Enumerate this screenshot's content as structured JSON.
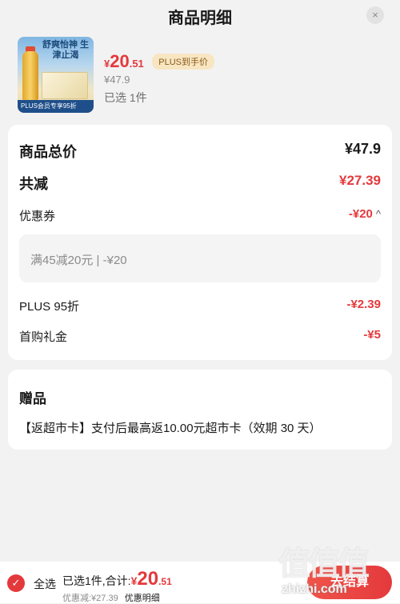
{
  "header": {
    "title": "商品明细",
    "close_icon": "×"
  },
  "product": {
    "thumb_slogan": "舒爽怡神 生津止渴",
    "thumb_banner": "PLUS会员专享95折",
    "price_symbol": "¥",
    "price_main": "20",
    "price_decimal": ".51",
    "plus_badge": "PLUS到手价",
    "original_price": "¥47.9",
    "selected": "已选 1件"
  },
  "summary": {
    "goods_total_label": "商品总价",
    "goods_total_value": "¥47.9",
    "total_off_label": "共减",
    "total_off_value": "¥27.39",
    "coupon_label": "优惠券",
    "coupon_value": "-¥20",
    "coupon_chevron": "^",
    "coupon_detail": "满45减20元 | -¥20",
    "plus_label": "PLUS 95折",
    "plus_value": "-¥2.39",
    "first_buy_label": "首购礼金",
    "first_buy_value": "-¥5"
  },
  "gift": {
    "title": "赠品",
    "desc": "【返超市卡】支付后最高返10.00元超市卡（效期 30 天）"
  },
  "footer": {
    "check_icon": "✓",
    "select_all": "全选",
    "total_label": "已选1件,合计:",
    "total_symbol": "¥",
    "total_main": "20",
    "total_decimal": ".51",
    "discount_text": "优惠减:¥27.39",
    "details_link": "优惠明细",
    "checkout": "去结算"
  },
  "watermark": {
    "logo": "值值值",
    "text": "zhizhi.com"
  },
  "colors": {
    "accent": "#e4393c",
    "background": "#f2f2f2",
    "card": "#ffffff"
  }
}
